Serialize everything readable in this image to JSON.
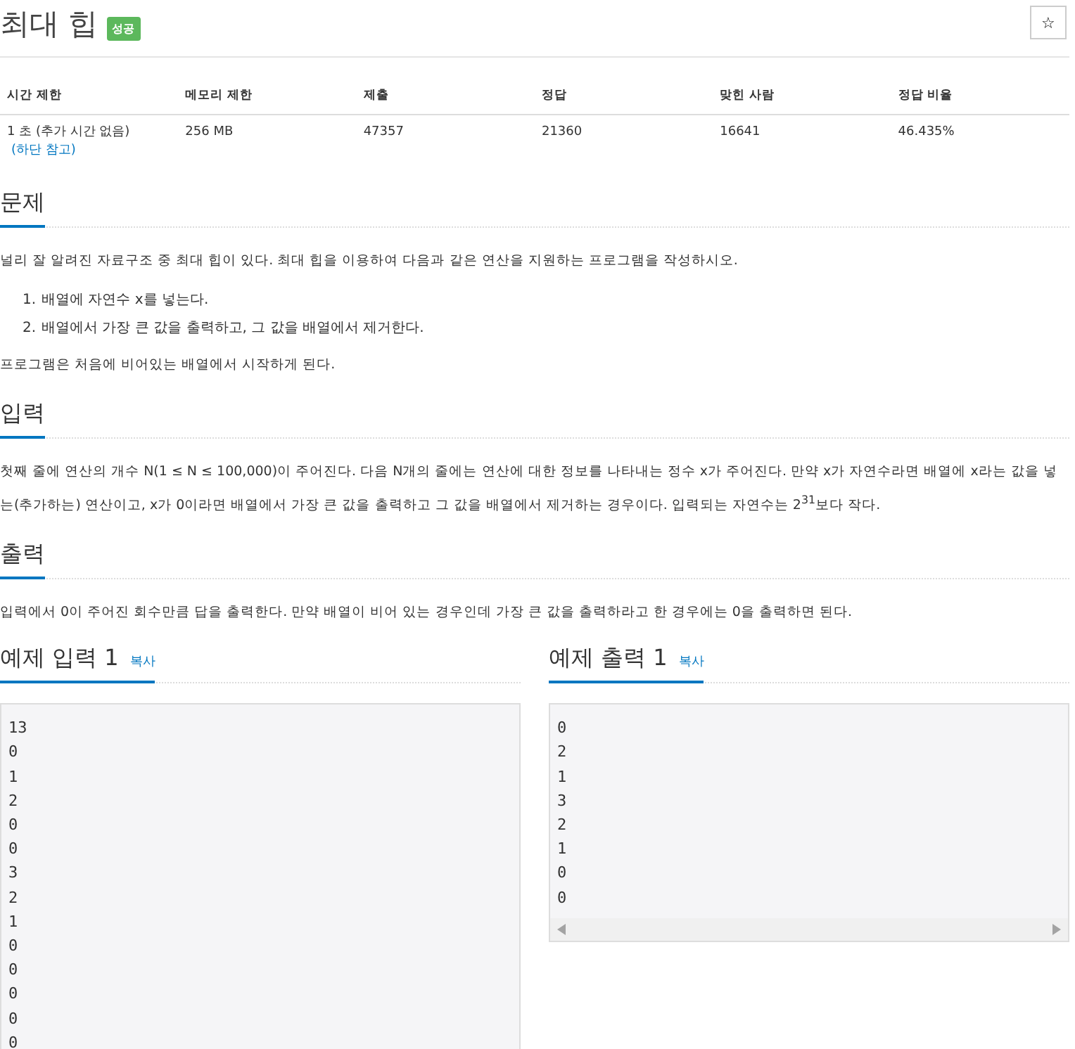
{
  "title": "최대 힙",
  "badge": "성공",
  "star_button": "☆",
  "info_table": {
    "columns": [
      "시간 제한",
      "메모리 제한",
      "제출",
      "정답",
      "맞힌 사람",
      "정답 비율"
    ],
    "row": [
      {
        "text": "1 초 (추가 시간 없음)",
        "link": "(하단 참고)"
      },
      {
        "text": "256 MB"
      },
      {
        "text": "47357"
      },
      {
        "text": "21360"
      },
      {
        "text": "16641"
      },
      {
        "text": "46.435%"
      }
    ]
  },
  "sections": [
    {
      "heading": "문제",
      "blocks": [
        {
          "kind": "paragraph",
          "text": "널리 잘 알려진 자료구조 중 최대 힙이 있다. 최대 힙을 이용하여 다음과 같은 연산을 지원하는 프로그램을 작성하시오."
        },
        {
          "kind": "list",
          "items": [
            {
              "number": "1.",
              "text": "배열에 자연수 x를 넣는다."
            },
            {
              "number": "2.",
              "text": "배열에서 가장 큰 값을 출력하고, 그 값을 배열에서 제거한다."
            }
          ]
        },
        {
          "kind": "paragraph",
          "text": "프로그램은 처음에 비어있는 배열에서 시작하게 된다."
        }
      ]
    },
    {
      "heading": "입력",
      "blocks": [
        {
          "kind": "paragraph",
          "text": "첫째 줄에 연산의 개수 N(1 ≤ N ≤ 100,000)이 주어진다. 다음 N개의 줄에는 연산에 대한 정보를 나타내는 정수 x가 주어진다. 만약 x가 자연수라면 배열에 x라는 값을 넣는(추가하는) 연산이고, x가 0이라면 배열에서 가장 큰 값을 출력하고 그 값을 배열에서 제거하는 경우이다. 입력되는 자연수는 2$^{31}$보다 작다."
        }
      ]
    },
    {
      "heading": "출력",
      "blocks": [
        {
          "kind": "paragraph",
          "text": "입력에서 0이 주어진 회수만큼 답을 출력한다. 만약 배열이 비어 있는 경우인데 가장 큰 값을 출력하라고 한 경우에는 0을 출력하면 된다."
        }
      ]
    }
  ],
  "samples": [
    {
      "heading": "예제 입력 1",
      "copy": "복사",
      "lines": [
        "13",
        "0",
        "1",
        "2",
        "0",
        "0",
        "3",
        "2",
        "1",
        "0",
        "0",
        "0",
        "0",
        "0"
      ]
    },
    {
      "heading": "예제 출력 1",
      "copy": "복사",
      "lines": [
        "0",
        "2",
        "1",
        "3",
        "2",
        "1",
        "0",
        "0"
      ],
      "scrollbar": true
    }
  ]
}
